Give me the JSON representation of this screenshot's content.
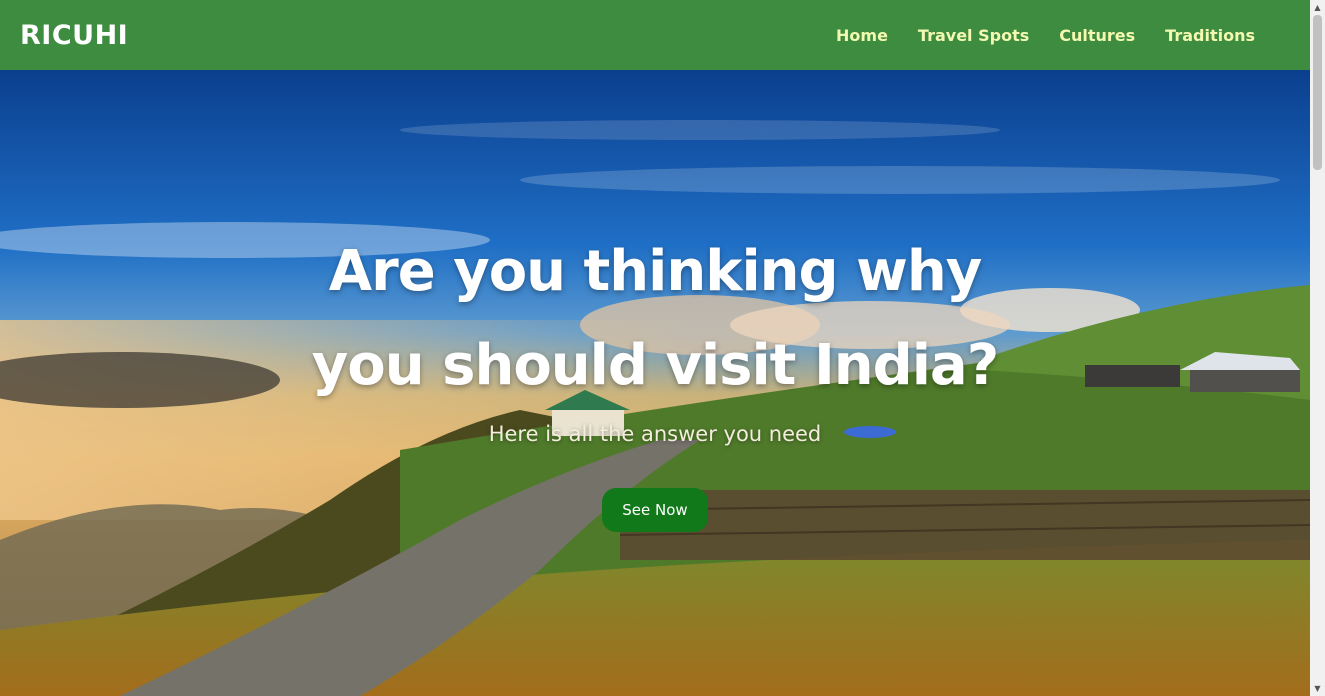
{
  "nav": {
    "brand": "RICUHI",
    "links": [
      {
        "label": "Home"
      },
      {
        "label": "Travel Spots"
      },
      {
        "label": "Cultures"
      },
      {
        "label": "Traditions"
      }
    ]
  },
  "hero": {
    "headline_line1": "Are you thinking why",
    "headline_line2": "you should visit India?",
    "subheadline": "Here is all the answer you need",
    "cta_label": "See Now"
  },
  "colors": {
    "navbar": "#3d8c40",
    "nav_link": "#f3f9b0",
    "cta": "#11791a"
  },
  "icons": {
    "scroll_up": "chevron-up-icon",
    "scroll_down": "chevron-down-icon"
  }
}
